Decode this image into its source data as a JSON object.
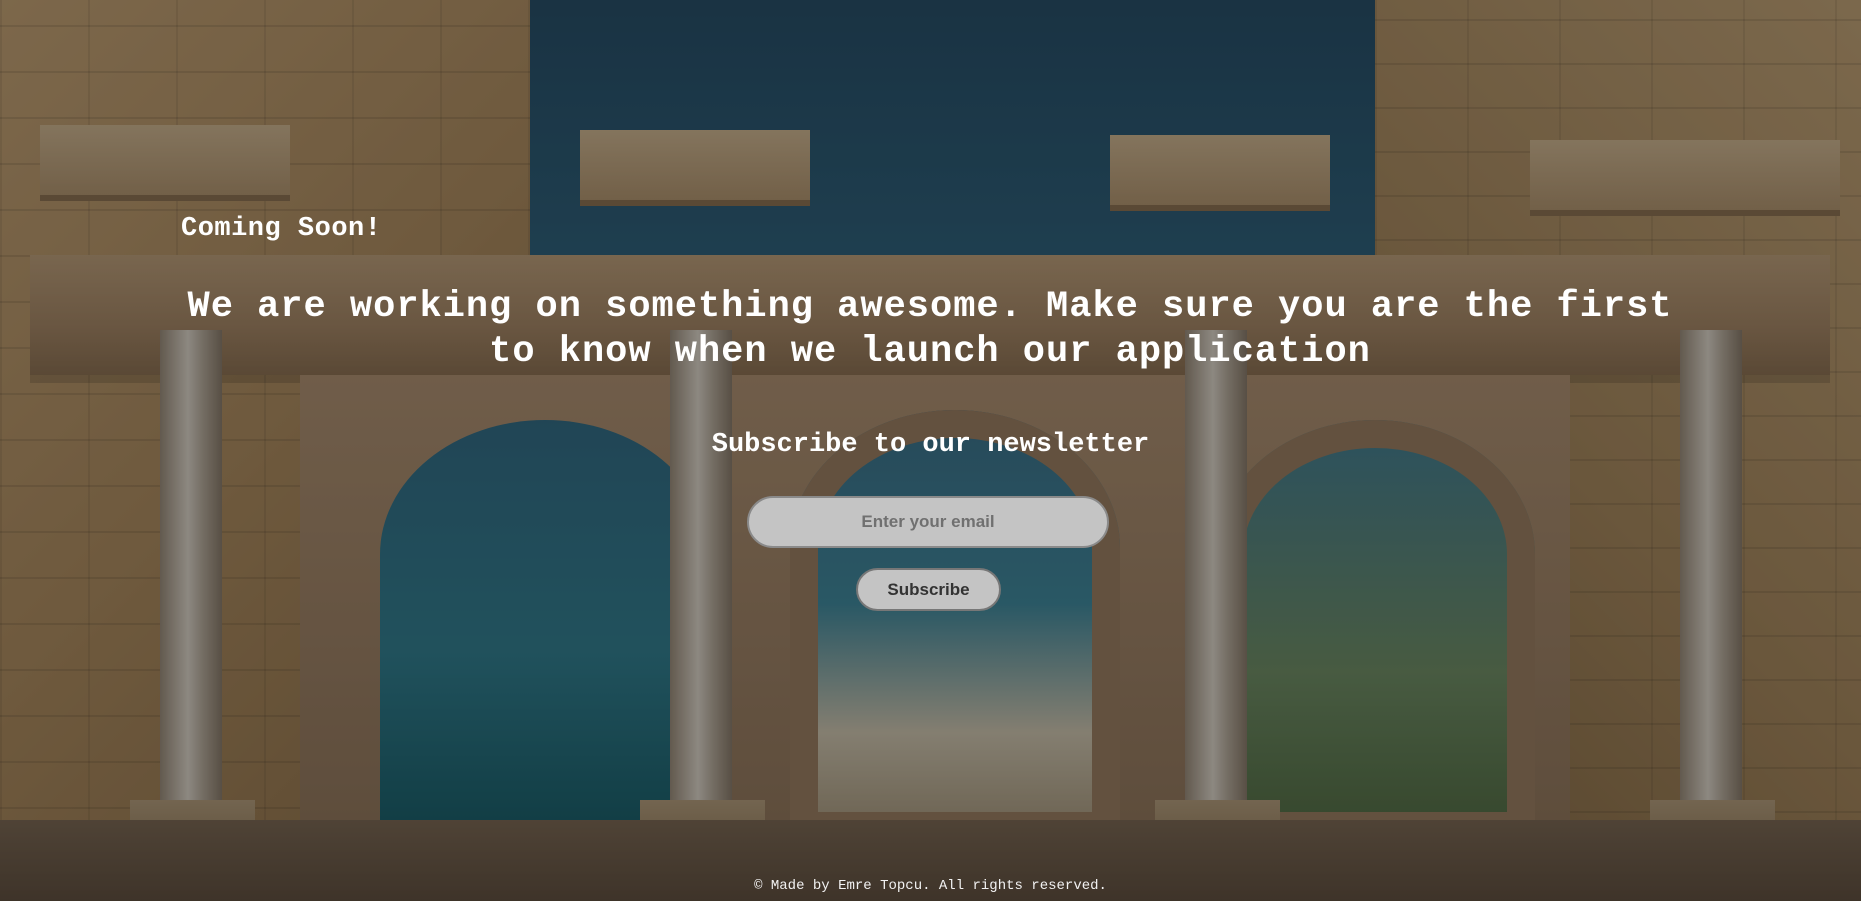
{
  "page": {
    "coming_soon": "Coming Soon!",
    "headline": "We are working on something awesome. Make sure you are the first to know when we launch our application",
    "newsletter_title": "Subscribe to our newsletter"
  },
  "form": {
    "email_placeholder": "Enter your email",
    "email_value": "",
    "subscribe_label": "Subscribe"
  },
  "footer": {
    "text": "© Made by Emre Topcu. All rights reserved."
  },
  "theme": {
    "overlay_color": "#141414",
    "input_bg": "#c4c4c4",
    "text_color": "#ffffff"
  },
  "background": {
    "icon": "ancient-gate-photo"
  }
}
